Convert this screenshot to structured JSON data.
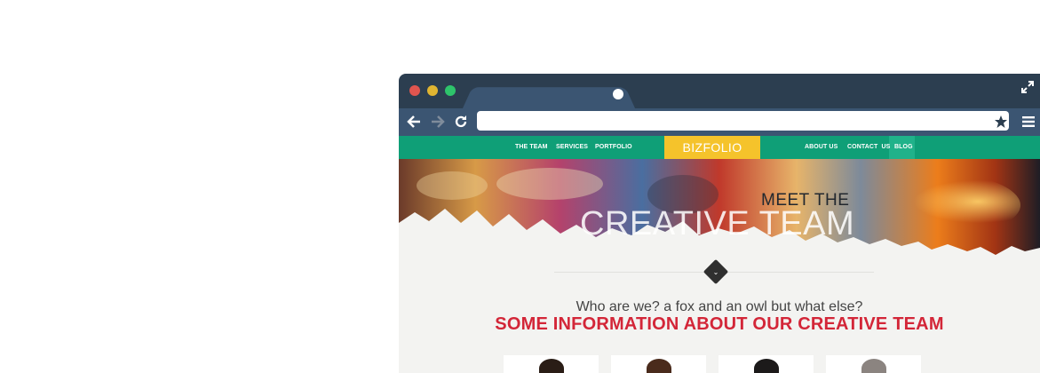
{
  "browser": {
    "window_controls": [
      "close-dot",
      "minimize-dot",
      "maximize-dot"
    ],
    "toolbar_icons": [
      "back-arrow-icon",
      "forward-arrow-icon",
      "reload-icon",
      "star-icon",
      "menu-icon",
      "fullscreen-icon"
    ],
    "address_value": ""
  },
  "site": {
    "nav_left": [
      "THE TEAM",
      "SERVICES",
      "PORTFOLIO"
    ],
    "brand": "BIZFOLIO",
    "nav_right": [
      "ABOUT US",
      "CONTACT  US",
      "BLOG"
    ],
    "hero": {
      "line1": "MEET THE",
      "line2": "CREATIVE TEAM"
    },
    "intro": {
      "question": "Who are we? a fox and an owl but what else?",
      "heading": "SOME INFORMATION ABOUT OUR CREATIVE TEAM"
    },
    "team_cards": 4
  },
  "colors": {
    "browser_chrome": "#2c3e50",
    "nav_green": "#0f9f77",
    "brand_yellow": "#f5c32b",
    "heading_red": "#d32638"
  }
}
